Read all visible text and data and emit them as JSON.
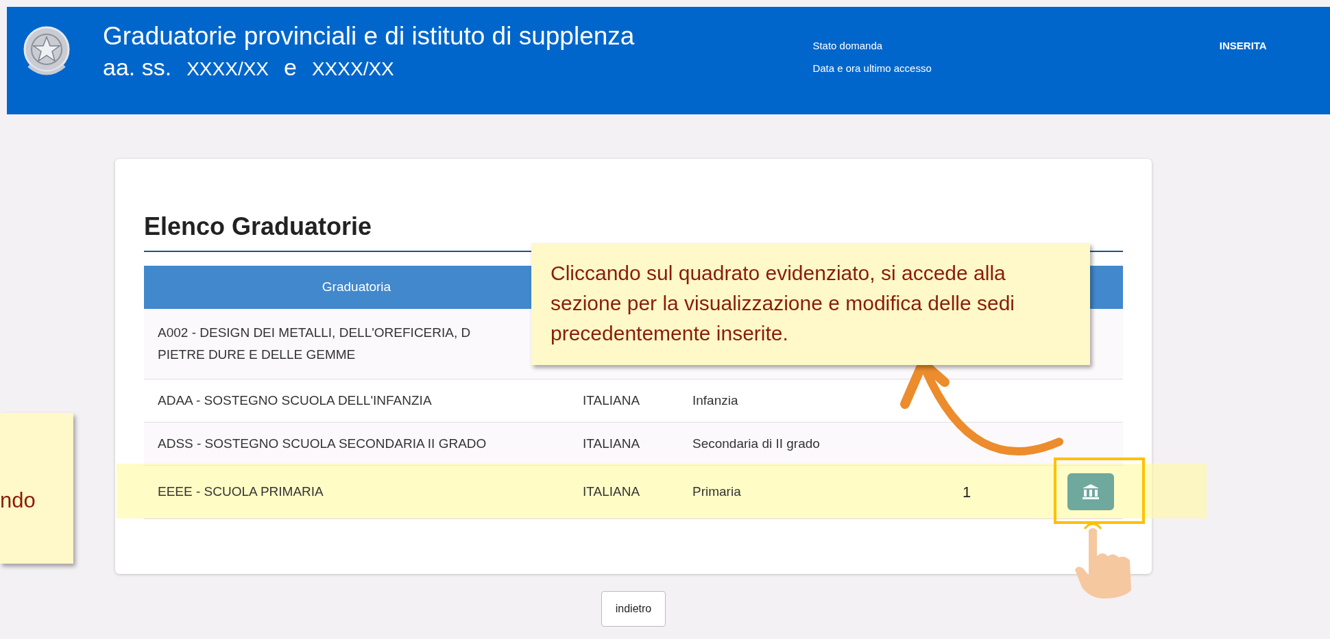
{
  "header": {
    "title": "Graduatorie provinciali e di istituto di supplenza",
    "subtitle": [
      "aa. ss.",
      "XXXX/XX",
      "e",
      "XXXX/XX"
    ],
    "status_labels": [
      "Stato domanda",
      "Data e ora ultimo accesso"
    ],
    "status_value": "INSERITA"
  },
  "card": {
    "title": "Elenco Graduatorie",
    "table": {
      "columns": [
        "Graduatoria"
      ],
      "rows": [
        {
          "cells": [
            [
              "A002 - DESIGN DEI METALLI, DELL'OREFICERIA, D",
              "PIETRE DURE E DELLE GEMME"
            ]
          ],
          "highlighted": false,
          "action_button": false
        },
        {
          "cells": [
            [
              "ADAA - SOSTEGNO SCUOLA DELL'INFANZIA"
            ],
            [
              "ITALIANA"
            ],
            [
              "Infanzia"
            ]
          ],
          "highlighted": false,
          "action_button": false
        },
        {
          "cells": [
            [
              "ADSS - SOSTEGNO SCUOLA SECONDARIA II GRADO"
            ],
            [
              "ITALIANA"
            ],
            [
              "Secondaria di II grado"
            ]
          ],
          "highlighted": false,
          "action_button": false
        },
        {
          "cells": [
            [
              "EEEE - SCUOLA PRIMARIA"
            ],
            [
              "ITALIANA"
            ],
            [
              "Primaria"
            ],
            [
              "1"
            ]
          ],
          "highlighted": true,
          "action_button": true
        }
      ]
    }
  },
  "callouts": [
    {
      "text": "Cliccando sul quadrato evidenziato, si accede alla sezione per la visualizzazione e modifica delle sedi precedentemente inserite."
    },
    {
      "text": "ndo"
    }
  ],
  "back_button": "indietro"
}
